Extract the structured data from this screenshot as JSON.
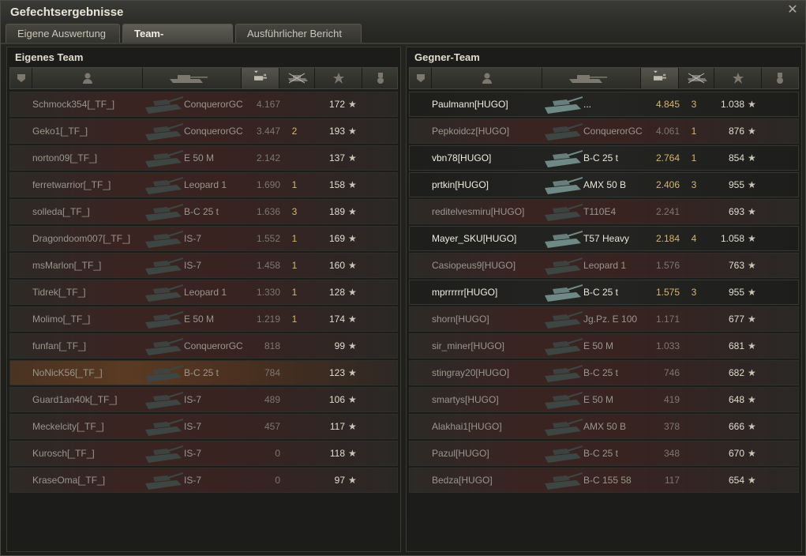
{
  "window": {
    "title": "Gefechtsergebnisse"
  },
  "tabs": [
    {
      "label": "Eigene Auswertung"
    },
    {
      "label": "Team-Auswertung"
    },
    {
      "label": "Ausführlicher Bericht"
    }
  ],
  "active_tab": "Team-Auswertung",
  "icons": {
    "close": "close-icon",
    "header": [
      "squad-icon",
      "player-icon",
      "tank-icon",
      "damage-icon",
      "kills-icon",
      "xp-star-icon",
      "medal-icon"
    ],
    "star": "★"
  },
  "colors": {
    "gold": "#d8b66a",
    "destroyed_row": "#3a2422",
    "self_row": "#5a3a22"
  },
  "own_team": {
    "title": "Eigenes Team",
    "players": [
      {
        "name": "Schmock354[_TF_]",
        "tank": "ConquerorGC",
        "damage": "4.167",
        "kills": "",
        "xp": "172",
        "alive": false,
        "self": false
      },
      {
        "name": "Geko1[_TF_]",
        "tank": "ConquerorGC",
        "damage": "3.447",
        "kills": "2",
        "xp": "193",
        "alive": false,
        "self": false
      },
      {
        "name": "norton09[_TF_]",
        "tank": "E 50 M",
        "damage": "2.142",
        "kills": "",
        "xp": "137",
        "alive": false,
        "self": false
      },
      {
        "name": "ferretwarrior[_TF_]",
        "tank": "Leopard 1",
        "damage": "1.690",
        "kills": "1",
        "xp": "158",
        "alive": false,
        "self": false
      },
      {
        "name": "solleda[_TF_]",
        "tank": "B-C 25 t",
        "damage": "1.636",
        "kills": "3",
        "xp": "189",
        "alive": false,
        "self": false
      },
      {
        "name": "Dragondoom007[_TF_]",
        "tank": "IS-7",
        "damage": "1.552",
        "kills": "1",
        "xp": "169",
        "alive": false,
        "self": false
      },
      {
        "name": "msMarlon[_TF_]",
        "tank": "IS-7",
        "damage": "1.458",
        "kills": "1",
        "xp": "160",
        "alive": false,
        "self": false
      },
      {
        "name": "Tidrek[_TF_]",
        "tank": "Leopard 1",
        "damage": "1.330",
        "kills": "1",
        "xp": "128",
        "alive": false,
        "self": false
      },
      {
        "name": "Molimo[_TF_]",
        "tank": "E 50 M",
        "damage": "1.219",
        "kills": "1",
        "xp": "174",
        "alive": false,
        "self": false
      },
      {
        "name": "funfan[_TF_]",
        "tank": "ConquerorGC",
        "damage": "818",
        "kills": "",
        "xp": "99",
        "alive": false,
        "self": false
      },
      {
        "name": "NoNicK56[_TF_]",
        "tank": "B-C 25 t",
        "damage": "784",
        "kills": "",
        "xp": "123",
        "alive": false,
        "self": true
      },
      {
        "name": "Guard1an40k[_TF_]",
        "tank": "IS-7",
        "damage": "489",
        "kills": "",
        "xp": "106",
        "alive": false,
        "self": false
      },
      {
        "name": "Meckelcity[_TF_]",
        "tank": "IS-7",
        "damage": "457",
        "kills": "",
        "xp": "117",
        "alive": false,
        "self": false
      },
      {
        "name": "Kurosch[_TF_]",
        "tank": "IS-7",
        "damage": "0",
        "kills": "",
        "xp": "118",
        "alive": false,
        "self": false
      },
      {
        "name": "KraseOma[_TF_]",
        "tank": "IS-7",
        "damage": "0",
        "kills": "",
        "xp": "97",
        "alive": false,
        "self": false
      }
    ]
  },
  "enemy_team": {
    "title": "Gegner-Team",
    "players": [
      {
        "name": "Paulmann[HUGO]",
        "tank": "...",
        "damage": "4.845",
        "kills": "3",
        "xp": "1.038",
        "alive": true,
        "self": false
      },
      {
        "name": "Pepkoidcz[HUGO]",
        "tank": "ConquerorGC",
        "damage": "4.061",
        "kills": "1",
        "xp": "876",
        "alive": false,
        "self": false
      },
      {
        "name": "vbn78[HUGO]",
        "tank": "B-C 25 t",
        "damage": "2.764",
        "kills": "1",
        "xp": "854",
        "alive": true,
        "self": false
      },
      {
        "name": "prtkin[HUGO]",
        "tank": "AMX 50 B",
        "damage": "2.406",
        "kills": "3",
        "xp": "955",
        "alive": true,
        "self": false
      },
      {
        "name": "reditelvesmiru[HUGO]",
        "tank": "T110E4",
        "damage": "2.241",
        "kills": "",
        "xp": "693",
        "alive": false,
        "self": false
      },
      {
        "name": "Mayer_SKU[HUGO]",
        "tank": "T57 Heavy",
        "damage": "2.184",
        "kills": "4",
        "xp": "1.058",
        "alive": true,
        "self": false
      },
      {
        "name": "Casiopeus9[HUGO]",
        "tank": "Leopard 1",
        "damage": "1.576",
        "kills": "",
        "xp": "763",
        "alive": false,
        "self": false
      },
      {
        "name": "mprrrrrr[HUGO]",
        "tank": "B-C 25 t",
        "damage": "1.575",
        "kills": "3",
        "xp": "955",
        "alive": true,
        "self": false
      },
      {
        "name": "shorn[HUGO]",
        "tank": "Jg.Pz. E 100",
        "damage": "1.171",
        "kills": "",
        "xp": "677",
        "alive": false,
        "self": false
      },
      {
        "name": "sir_miner[HUGO]",
        "tank": "E 50 M",
        "damage": "1.033",
        "kills": "",
        "xp": "681",
        "alive": false,
        "self": false
      },
      {
        "name": "stingray20[HUGO]",
        "tank": "B-C 25 t",
        "damage": "746",
        "kills": "",
        "xp": "682",
        "alive": false,
        "self": false
      },
      {
        "name": "smartys[HUGO]",
        "tank": "E 50 M",
        "damage": "419",
        "kills": "",
        "xp": "648",
        "alive": false,
        "self": false
      },
      {
        "name": "Alakhai1[HUGO]",
        "tank": "AMX 50 B",
        "damage": "378",
        "kills": "",
        "xp": "666",
        "alive": false,
        "self": false
      },
      {
        "name": "Pazul[HUGO]",
        "tank": "B-C 25 t",
        "damage": "348",
        "kills": "",
        "xp": "670",
        "alive": false,
        "self": false
      },
      {
        "name": "Bedza[HUGO]",
        "tank": "B-C 155 58",
        "damage": "117",
        "kills": "",
        "xp": "654",
        "alive": false,
        "self": false
      }
    ]
  }
}
